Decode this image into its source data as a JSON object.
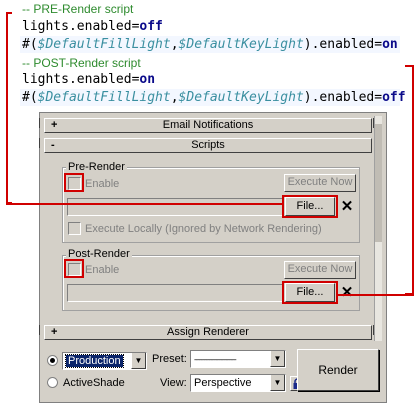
{
  "code": {
    "pre_comment": "-- PRE-Render script",
    "pre_line1_prefix": "lights.enabled=",
    "pre_line1_value": "off",
    "pre_line2_open": "#(",
    "pre_line2_var1": "$DefaultFillLight",
    "pre_line2_comma": ",",
    "pre_line2_var2": "$DefaultKeyLight",
    "pre_line2_suffix": ").enabled=",
    "pre_line2_value": "on",
    "post_comment": "-- POST-Render script",
    "post_line1_prefix": "lights.enabled=",
    "post_line1_value": "on",
    "post_line2_open": "#(",
    "post_line2_var1": "$DefaultFillLight",
    "post_line2_comma": ",",
    "post_line2_var2": "$DefaultKeyLight",
    "post_line2_suffix": ").enabled=",
    "post_line2_value": "off"
  },
  "rollouts": {
    "email": {
      "sign": "+",
      "label": "Email Notifications"
    },
    "scripts": {
      "sign": "-",
      "label": "Scripts"
    },
    "assign": {
      "sign": "+",
      "label": "Assign Renderer"
    }
  },
  "pre_render": {
    "group_label": "Pre-Render",
    "enable_label": "Enable",
    "execute_now": "Execute Now",
    "file_button": "File...",
    "clear_glyph": "✕",
    "execute_locally": "Execute Locally (Ignored by Network Rendering)"
  },
  "post_render": {
    "group_label": "Post-Render",
    "enable_label": "Enable",
    "execute_now": "Execute Now",
    "file_button": "File...",
    "clear_glyph": "✕"
  },
  "bottom": {
    "mode_production_selected": true,
    "production_value": "Production",
    "activeshade_label": "ActiveShade",
    "preset_label": "Preset:",
    "preset_value": "-------------------------",
    "view_label": "View:",
    "view_value": "Perspective",
    "render_label": "Render"
  },
  "icons": {
    "dropdown_arrow": "chevron-down-icon",
    "lock": "lock-icon",
    "clear": "close-icon"
  },
  "colors": {
    "highlight_red": "#d00000",
    "comment_green": "#2e8b2e",
    "keyword_blue": "#0a0a8a",
    "variable_teal": "#3a8fa0",
    "panel_gray": "#d4d0c8"
  }
}
